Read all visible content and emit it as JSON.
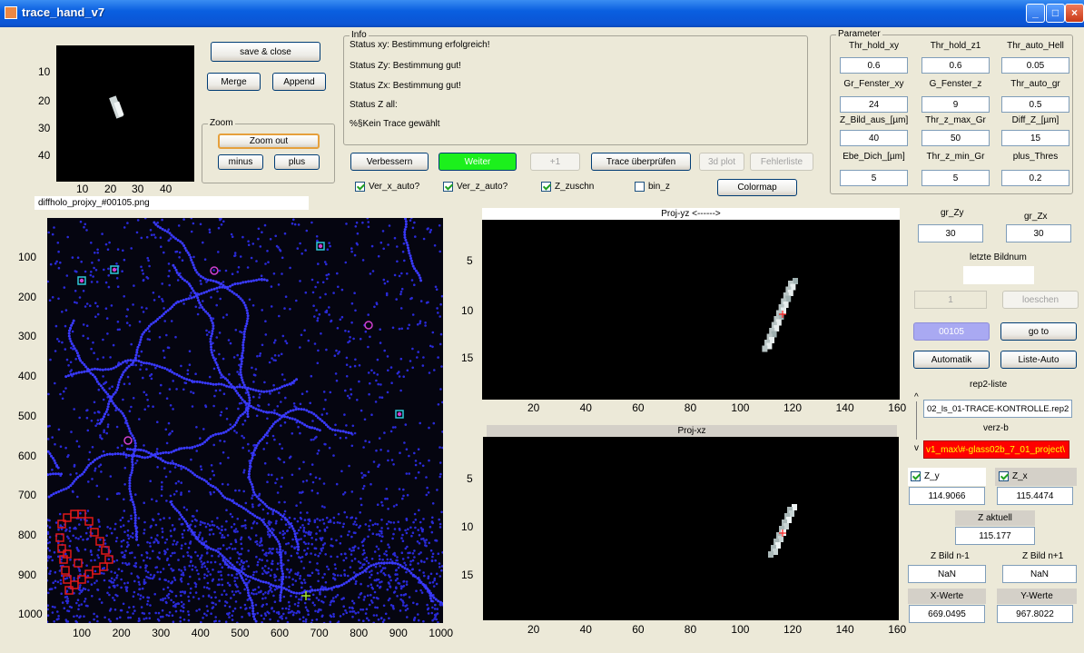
{
  "window": {
    "title": "trace_hand_v7",
    "min_icon": "minimize-icon",
    "max_icon": "maximize-icon",
    "close_icon": "close-icon"
  },
  "thumbnail": {
    "yticks": [
      "10",
      "20",
      "30",
      "40"
    ],
    "xticks": [
      "10",
      "20",
      "30",
      "40"
    ],
    "filename": "diffholo_projxy_#00105.png"
  },
  "buttons": {
    "save_close": "save & close",
    "merge": "Merge",
    "append": "Append",
    "zoom_out": "Zoom out",
    "minus": "minus",
    "plus": "plus",
    "verbessern": "Verbessern",
    "weiter": "Weiter",
    "plus1": "+1",
    "trace_check": "Trace überprüfen",
    "plot3d": "3d plot",
    "fehlerliste": "Fehlerliste",
    "colormap": "Colormap",
    "loeschen": "loeschen",
    "goto": "go to",
    "automatik": "Automatik",
    "liste_auto": "Liste-Auto"
  },
  "zoom": {
    "title": "Zoom"
  },
  "info": {
    "title": "Info",
    "lines": [
      "Status xy: Bestimmung erfolgreich!",
      "Status  Zy: Bestimmung gut!",
      "Status  Zx: Bestimmung gut!",
      "Status Z all:",
      "%§Kein Trace gewählt"
    ]
  },
  "checkboxes": {
    "ver_x": "Ver_x_auto?",
    "ver_z": "Ver_z_auto?",
    "z_zuschn": "Z_zuschn",
    "bin_z": "bin_z"
  },
  "parameter": {
    "title": "Parameter",
    "rows": [
      {
        "labels": [
          "Thr_hold_xy",
          "Thr_hold_z1",
          "Thr_auto_Hell"
        ],
        "values": [
          "0.6",
          "0.6",
          "0.05"
        ]
      },
      {
        "labels": [
          "Gr_Fenster_xy",
          "G_Fenster_z",
          "Thr_auto_gr"
        ],
        "values": [
          "24",
          "9",
          "0.5"
        ]
      },
      {
        "labels": [
          "Z_Bild_aus_[µm]",
          "Thr_z_max_Gr",
          "Diff_Z_[µm]"
        ],
        "values": [
          "40",
          "50",
          "15"
        ]
      },
      {
        "labels": [
          "Ebe_Dich_[µm]",
          "Thr_z_min_Gr",
          "plus_Thres"
        ],
        "values": [
          "5",
          "5",
          "0.2"
        ]
      }
    ]
  },
  "main_plot": {
    "yticks": [
      "100",
      "200",
      "300",
      "400",
      "500",
      "600",
      "700",
      "800",
      "900",
      "1000"
    ],
    "xticks": [
      "100",
      "200",
      "300",
      "400",
      "500",
      "600",
      "700",
      "800",
      "900",
      "1000"
    ]
  },
  "proj_yz": {
    "title": "Proj-yz <------>",
    "yticks": [
      "5",
      "10",
      "15"
    ],
    "xticks": [
      "20",
      "40",
      "60",
      "80",
      "100",
      "120",
      "140",
      "160"
    ]
  },
  "proj_xz": {
    "title": "Proj-xz",
    "yticks": [
      "5",
      "10",
      "15"
    ],
    "xticks": [
      "20",
      "40",
      "60",
      "80",
      "100",
      "120",
      "140",
      "160"
    ]
  },
  "right": {
    "gr_zy_label": "gr_Zy",
    "gr_zx_label": "gr_Zx",
    "gr_zy": "30",
    "gr_zx": "30",
    "letzte_label": "letzte Bildnum",
    "letzte_value": "",
    "num_field": "1",
    "bildnum": "00105",
    "rep2_label": "rep2-liste",
    "rep2_value": "02_ls_01-TRACE-KONTROLLE.rep2",
    "verzb_label": "verz-b",
    "verzb_value": "v1_max\\#-glass02b_7_01_project\\",
    "scroll_up": "^",
    "scroll_down": "v",
    "zy_check": "Z_y",
    "zx_check": "Z_x",
    "zy_value": "114.9066",
    "zx_value": "115.4474",
    "z_aktuell_label": "Z aktuell",
    "z_aktuell": "115.177",
    "z_prev_label": "Z Bild n-1",
    "z_next_label": "Z Bild n+1",
    "z_prev": "NaN",
    "z_next": "NaN",
    "x_werte_label": "X-Werte",
    "y_werte_label": "Y-Werte",
    "x_werte": "669.0495",
    "y_werte": "967.8022"
  }
}
